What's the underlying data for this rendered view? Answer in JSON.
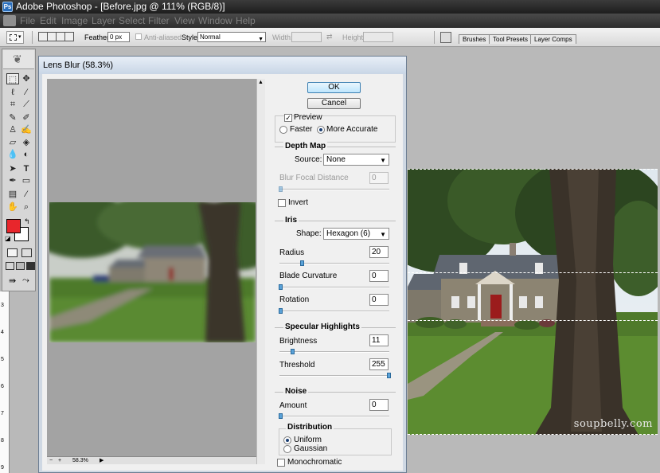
{
  "titlebar": {
    "title": "Adobe Photoshop - [Before.jpg @ 111% (RGB/8)]"
  },
  "menu": [
    "File",
    "Edit",
    "Image",
    "Layer",
    "Select",
    "Filter",
    "View",
    "Window",
    "Help"
  ],
  "options": {
    "feather_label": "Feather:",
    "feather_value": "0 px",
    "antialiased_label": "Anti-aliased",
    "style_label": "Style:",
    "style_value": "Normal",
    "width_label": "Width:",
    "height_label": "Height:"
  },
  "palette_tabs": [
    "Brushes",
    "Tool Presets",
    "Layer Comps"
  ],
  "ruler_ticks": [
    "3",
    "4",
    "5",
    "6",
    "7",
    "8",
    "9"
  ],
  "dialog": {
    "title": "Lens Blur (58.3%)",
    "ok": "OK",
    "cancel": "Cancel",
    "preview_label": "Preview",
    "preview_checked": true,
    "faster": "Faster",
    "more_accurate": "More Accurate",
    "preview_mode": "More Accurate",
    "zoom_value": "58.3%",
    "depth_map": {
      "title": "Depth Map",
      "source_label": "Source:",
      "source_value": "None",
      "blur_focal_label": "Blur Focal Distance",
      "blur_focal_value": "0",
      "invert_label": "Invert"
    },
    "iris": {
      "title": "Iris",
      "shape_label": "Shape:",
      "shape_value": "Hexagon (6)",
      "radius_label": "Radius",
      "radius_value": "20",
      "blade_label": "Blade Curvature",
      "blade_value": "0",
      "rotation_label": "Rotation",
      "rotation_value": "0"
    },
    "specular": {
      "title": "Specular Highlights",
      "brightness_label": "Brightness",
      "brightness_value": "11",
      "threshold_label": "Threshold",
      "threshold_value": "255"
    },
    "noise": {
      "title": "Noise",
      "amount_label": "Amount",
      "amount_value": "0",
      "distribution_title": "Distribution",
      "uniform": "Uniform",
      "gaussian": "Gaussian",
      "distribution_value": "Uniform",
      "monochromatic_label": "Monochromatic"
    }
  },
  "document": {
    "watermark": "soupbelly.com"
  },
  "colors": {
    "foreground": "#e8262c",
    "background": "#ffffff",
    "accent": "#3c7fb1"
  }
}
